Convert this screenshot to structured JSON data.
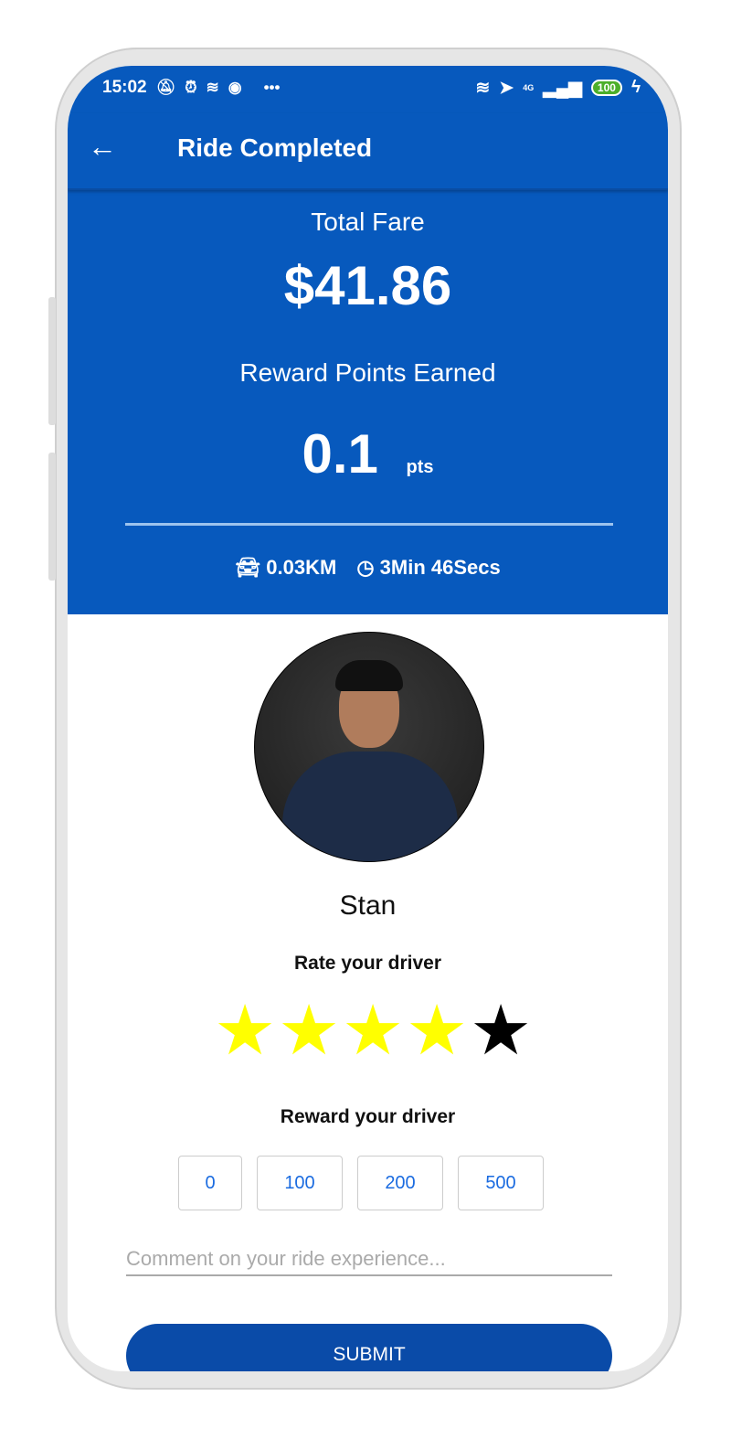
{
  "status_bar": {
    "time": "15:02",
    "battery": "100",
    "network": "4G",
    "more": "•••"
  },
  "header": {
    "title": "Ride Completed",
    "back_icon": "arrow-left-icon",
    "back": "←"
  },
  "fare": {
    "label": "Total Fare",
    "amount": "$41.86"
  },
  "rewards": {
    "label": "Reward Points Earned",
    "value": "0.1",
    "unit": "pts"
  },
  "trip": {
    "distance": "0.03KM",
    "duration": "3Min 46Secs"
  },
  "driver": {
    "name": "Stan",
    "rate_label": "Rate your driver",
    "rating": 4,
    "max_rating": 5,
    "reward_label": "Reward your driver",
    "reward_options": [
      "0",
      "100",
      "200",
      "500"
    ]
  },
  "comment": {
    "placeholder": "Comment on your ride experience..."
  },
  "submit_label": "SUBMIT",
  "colors": {
    "primary": "#0759BD",
    "star_on": "#FFFF00",
    "star_off": "#000000",
    "submit": "#0A4BA8"
  }
}
